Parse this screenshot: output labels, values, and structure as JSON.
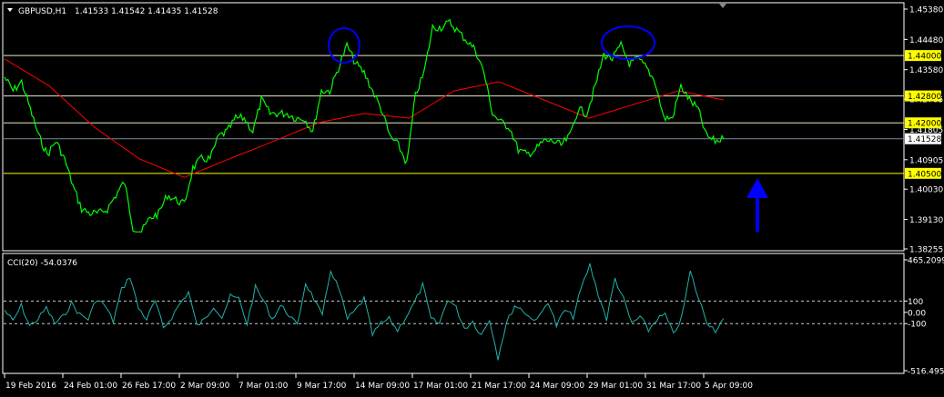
{
  "header": {
    "menu_icon": "triangle-down-icon",
    "symbol": "GBPUSD,H1",
    "ohlc": "1.41533 1.41542 1.41435 1.41528"
  },
  "indicator": {
    "label": "CCI(20) -54.0376"
  },
  "colors": {
    "background": "#000000",
    "price_line": "#00ff00",
    "moving_average": "#ff0000",
    "cci_line": "#20b2aa",
    "level_line": "#ffff00",
    "annotation": "#0000ff",
    "axis_text": "#ffffff"
  },
  "chart_data": [
    {
      "type": "line",
      "symbol": "GBPUSD,H1",
      "ylim": [
        1.38255,
        1.4538
      ],
      "y_ticks": [
        "1.45380",
        "1.44480",
        "1.43580",
        "1.42705",
        "1.41805",
        "1.40905",
        "1.40030",
        "1.39130",
        "1.38255"
      ],
      "x_ticks": [
        "19 Feb 2016",
        "24 Feb 01:00",
        "26 Feb 17:00",
        "2 Mar 09:00",
        "7 Mar 01:00",
        "9 Mar 17:00",
        "14 Mar 09:00",
        "17 Mar 01:00",
        "21 Mar 17:00",
        "24 Mar 09:00",
        "29 Mar 01:00",
        "31 Mar 17:00",
        "5 Apr 09:00"
      ],
      "levels": [
        {
          "value": 1.44,
          "label": "1.44000"
        },
        {
          "value": 1.428,
          "label": "1.42800"
        },
        {
          "value": 1.42,
          "label": "1.42000"
        },
        {
          "value": 1.405,
          "label": "1.40500"
        }
      ],
      "bid": {
        "value": 1.41528,
        "label": "1.41528"
      },
      "series": [
        {
          "values": [
            1.4336,
            1.4295,
            1.4322,
            1.4241,
            1.416,
            1.4106,
            1.4146,
            1.4093,
            1.4012,
            1.3944,
            1.3931,
            1.3931,
            1.3944,
            1.3985,
            1.4025,
            1.389,
            1.3877,
            1.3917,
            1.3931,
            1.3985,
            1.3971,
            1.3958,
            1.4066,
            1.4093,
            1.4093,
            1.416,
            1.4174,
            1.4214,
            1.4214,
            1.4174,
            1.4268,
            1.4228,
            1.4228,
            1.4228,
            1.4214,
            1.4214,
            1.4174,
            1.4295,
            1.4295,
            1.4363,
            1.443,
            1.4376,
            1.4349,
            1.4295,
            1.4241,
            1.416,
            1.4133,
            1.4079,
            1.4282,
            1.4349,
            1.4484,
            1.4484,
            1.4498,
            1.4471,
            1.4444,
            1.4417,
            1.4349,
            1.4228,
            1.4201,
            1.4187,
            1.412,
            1.4106,
            1.412,
            1.4146,
            1.4146,
            1.4133,
            1.416,
            1.4241,
            1.4228,
            1.4309,
            1.4403,
            1.439,
            1.443,
            1.4376,
            1.439,
            1.4363,
            1.4322,
            1.4214,
            1.4214,
            1.4309,
            1.4268,
            1.4241,
            1.416,
            1.4146,
            1.41528
          ]
        },
        {
          "values": [
            1.439,
            1.4309,
            1.4187,
            1.4093,
            1.4038,
            1.4093,
            1.4146,
            1.4201,
            1.4228,
            1.4214,
            1.4295,
            1.4322,
            1.4268,
            1.4214,
            1.4255,
            1.4295,
            1.4268
          ]
        }
      ]
    },
    {
      "type": "line",
      "title": "CCI(20) -54.0376",
      "ylim": [
        -516.4956,
        465.2099
      ],
      "y_ticks": [
        "465.2099",
        "100",
        "0.00",
        "-100",
        "-516.4956"
      ],
      "levels": [
        100,
        -100
      ],
      "values": [
        20,
        -80,
        60,
        -120,
        -60,
        40,
        -100,
        -40,
        80,
        -20,
        -60,
        120,
        60,
        -80,
        200,
        320,
        40,
        -60,
        100,
        -140,
        -40,
        80,
        180,
        -120,
        -60,
        60,
        -40,
        140,
        120,
        -100,
        220,
        100,
        -60,
        60,
        -20,
        -120,
        260,
        120,
        -40,
        380,
        200,
        -60,
        20,
        120,
        -200,
        -100,
        -60,
        -160,
        -40,
        80,
        240,
        -60,
        -100,
        120,
        40,
        -140,
        -80,
        -200,
        -60,
        -400,
        -100,
        60,
        20,
        -60,
        -40,
        100,
        -120,
        20,
        -40,
        220,
        420,
        160,
        -60,
        300,
        120,
        -100,
        -40,
        -160,
        -60,
        -20,
        -200,
        -40,
        360,
        120,
        -80,
        -160,
        -54
      ]
    }
  ]
}
